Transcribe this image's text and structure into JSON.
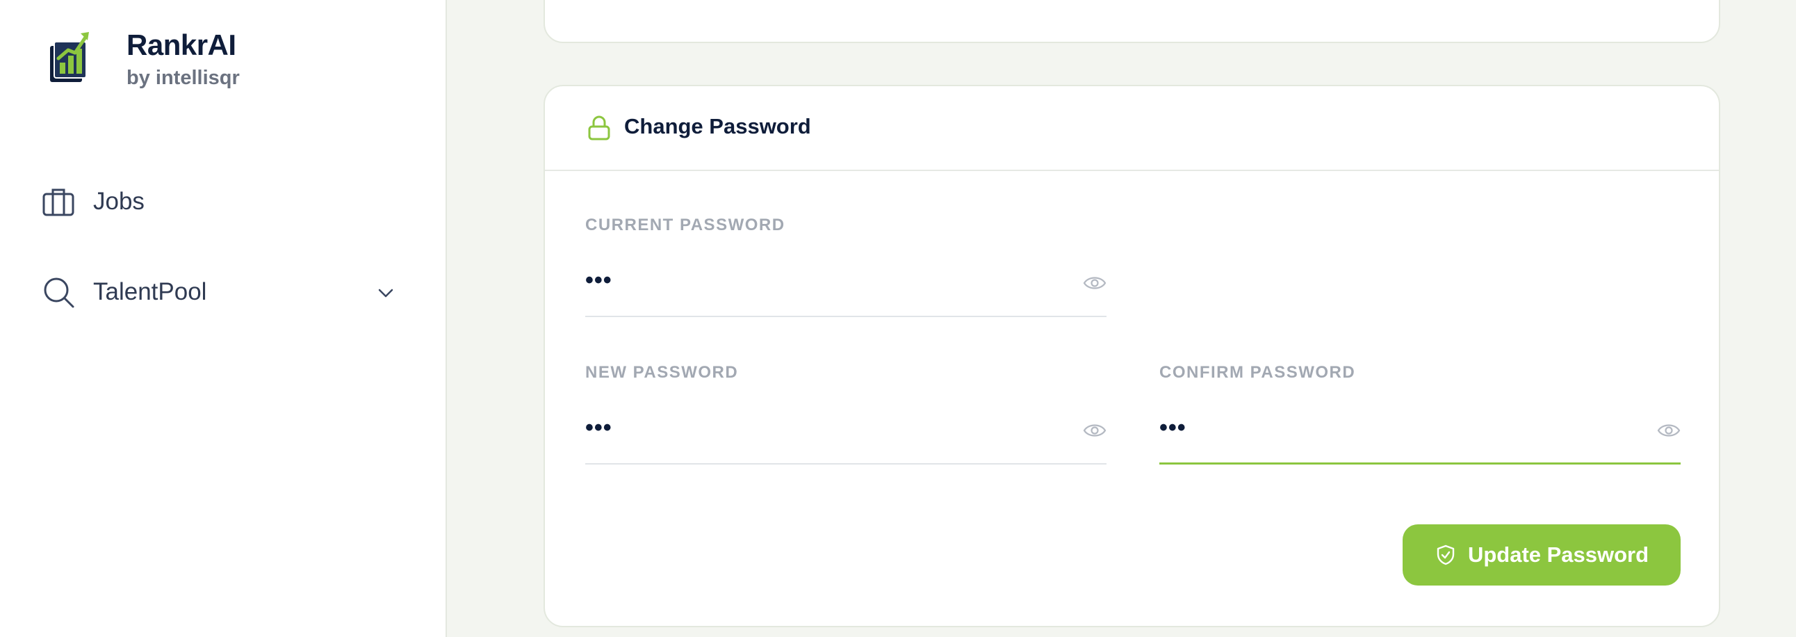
{
  "brand": {
    "name": "RankrAI",
    "sub": "by intellisqr",
    "accent_color": "#8cc63f",
    "dark_color": "#0f1d3a"
  },
  "sidebar": {
    "items": [
      {
        "label": "Jobs",
        "icon": "briefcase-icon"
      },
      {
        "label": "TalentPool",
        "icon": "search-icon",
        "expand_icon": "chevron-down-icon"
      }
    ]
  },
  "change_password": {
    "title": "Change Password",
    "icon": "lock-icon",
    "fields": {
      "current": {
        "label": "CURRENT PASSWORD",
        "value": "•••",
        "icon": "eye-icon"
      },
      "new": {
        "label": "NEW PASSWORD",
        "value": "•••",
        "icon": "eye-icon"
      },
      "confirm": {
        "label": "CONFIRM PASSWORD",
        "value": "•••",
        "icon": "eye-icon"
      }
    },
    "submit": {
      "label": "Update Password",
      "icon": "shield-check-icon"
    }
  }
}
